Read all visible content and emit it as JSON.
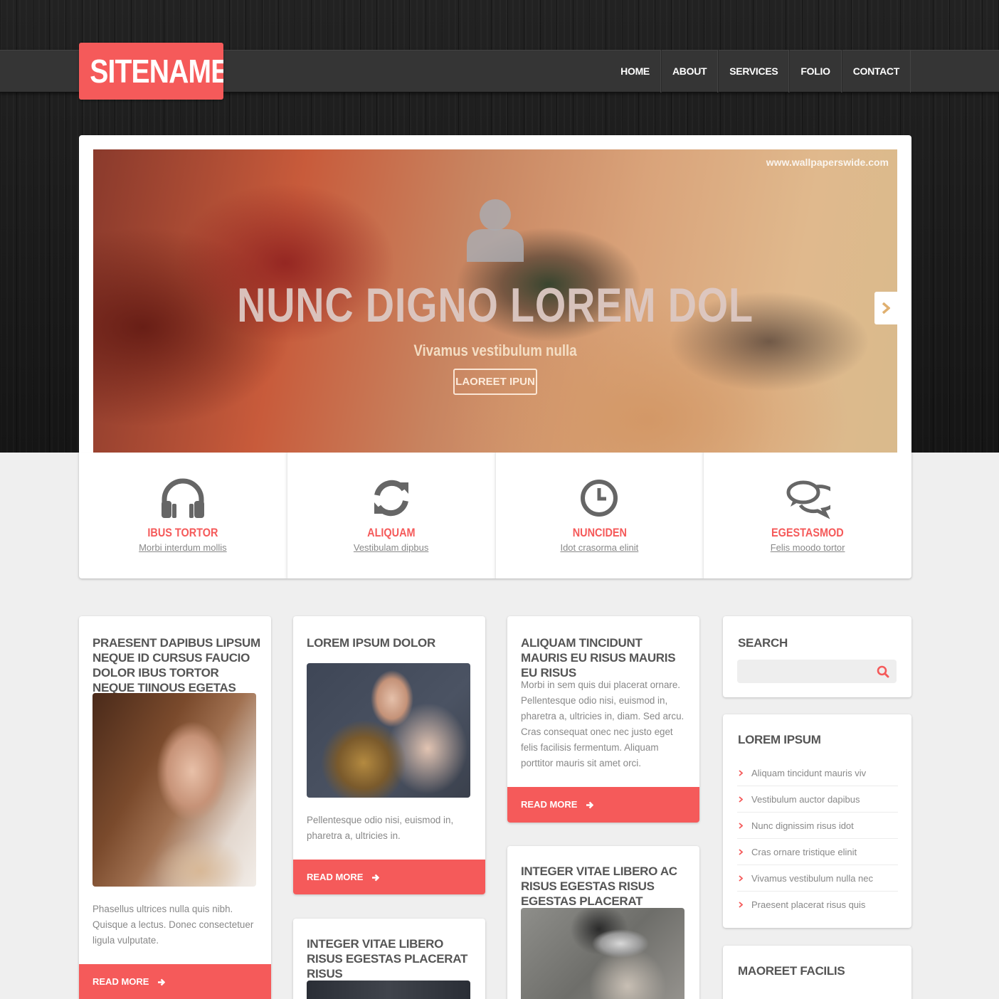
{
  "site": {
    "logo": "SITENAME"
  },
  "nav": {
    "items": [
      "HOME",
      "ABOUT",
      "SERVICES",
      "FOLIO",
      "CONTACT"
    ]
  },
  "slider": {
    "watermark": "www.wallpaperswide.com",
    "title": "NUNC DIGNO LOREM DOL",
    "subtitle": "Vivamus vestibulum nulla",
    "button_label": "LAOREET IPUN"
  },
  "features": [
    {
      "icon": "headphones-icon",
      "title": "IBUS TORTOR",
      "link": "Morbi interdum mollis"
    },
    {
      "icon": "refresh-icon",
      "title": "ALIQUAM",
      "link": "Vestibulam dipbus"
    },
    {
      "icon": "clock-icon",
      "title": "NUNCIDEN",
      "link": "Idot crasorma elinit"
    },
    {
      "icon": "chat-bubbles-icon",
      "title": "EGESTASMOD",
      "link": "Felis moodo tortor"
    }
  ],
  "posts": {
    "col1": {
      "title": "PRAESENT DAPIBUS LIPSUM NEQUE ID CURSUS FAUCIO DOLOR IBUS TORTOR NEQUE TIINOUS EGETAS AUGUE",
      "text": "Phasellus ultrices nulla quis nibh. Quisque a lectus. Donec consectetuer ligula vulputate.",
      "read_more": "READ MORE"
    },
    "col2a": {
      "title": "LOREM IPSUM DOLOR",
      "text": "Pellentesque odio nisi, euismod in, pharetra a, ultricies in.",
      "read_more": "READ MORE"
    },
    "col2b": {
      "title": "INTEGER VITAE LIBERO RISUS EGESTAS PLACERAT RISUS"
    },
    "col3a": {
      "title": "ALIQUAM TINCIDUNT MAURIS EU RISUS MAURIS EU RISUS",
      "text": "Morbi in sem quis dui placerat ornare. Pellentesque odio nisi, euismod in, pharetra a, ultricies in, diam. Sed arcu. Cras consequat onec nec justo eget felis facilisis fermentum. Aliquam porttitor mauris sit amet orci.",
      "read_more": "READ MORE"
    },
    "col3b": {
      "title": "INTEGER VITAE LIBERO AC RISUS EGESTAS RISUS EGESTAS PLACERAT"
    }
  },
  "sidebar": {
    "search": {
      "title": "SEARCH",
      "placeholder": ""
    },
    "list": {
      "title": "LOREM IPSUM",
      "items": [
        "Aliquam tincidunt mauris viv",
        "Vestibulum auctor dapibus",
        "Nunc dignissim risus idot",
        "Cras ornare tristique elinit",
        "Vivamus vestibulum nulla nec",
        "Praesent placerat risus quis"
      ]
    },
    "third": {
      "title": "MAOREET FACILIS"
    }
  },
  "colors": {
    "accent": "#f55a5a",
    "dark_bar": "#353535",
    "page_bg": "#efefef"
  }
}
